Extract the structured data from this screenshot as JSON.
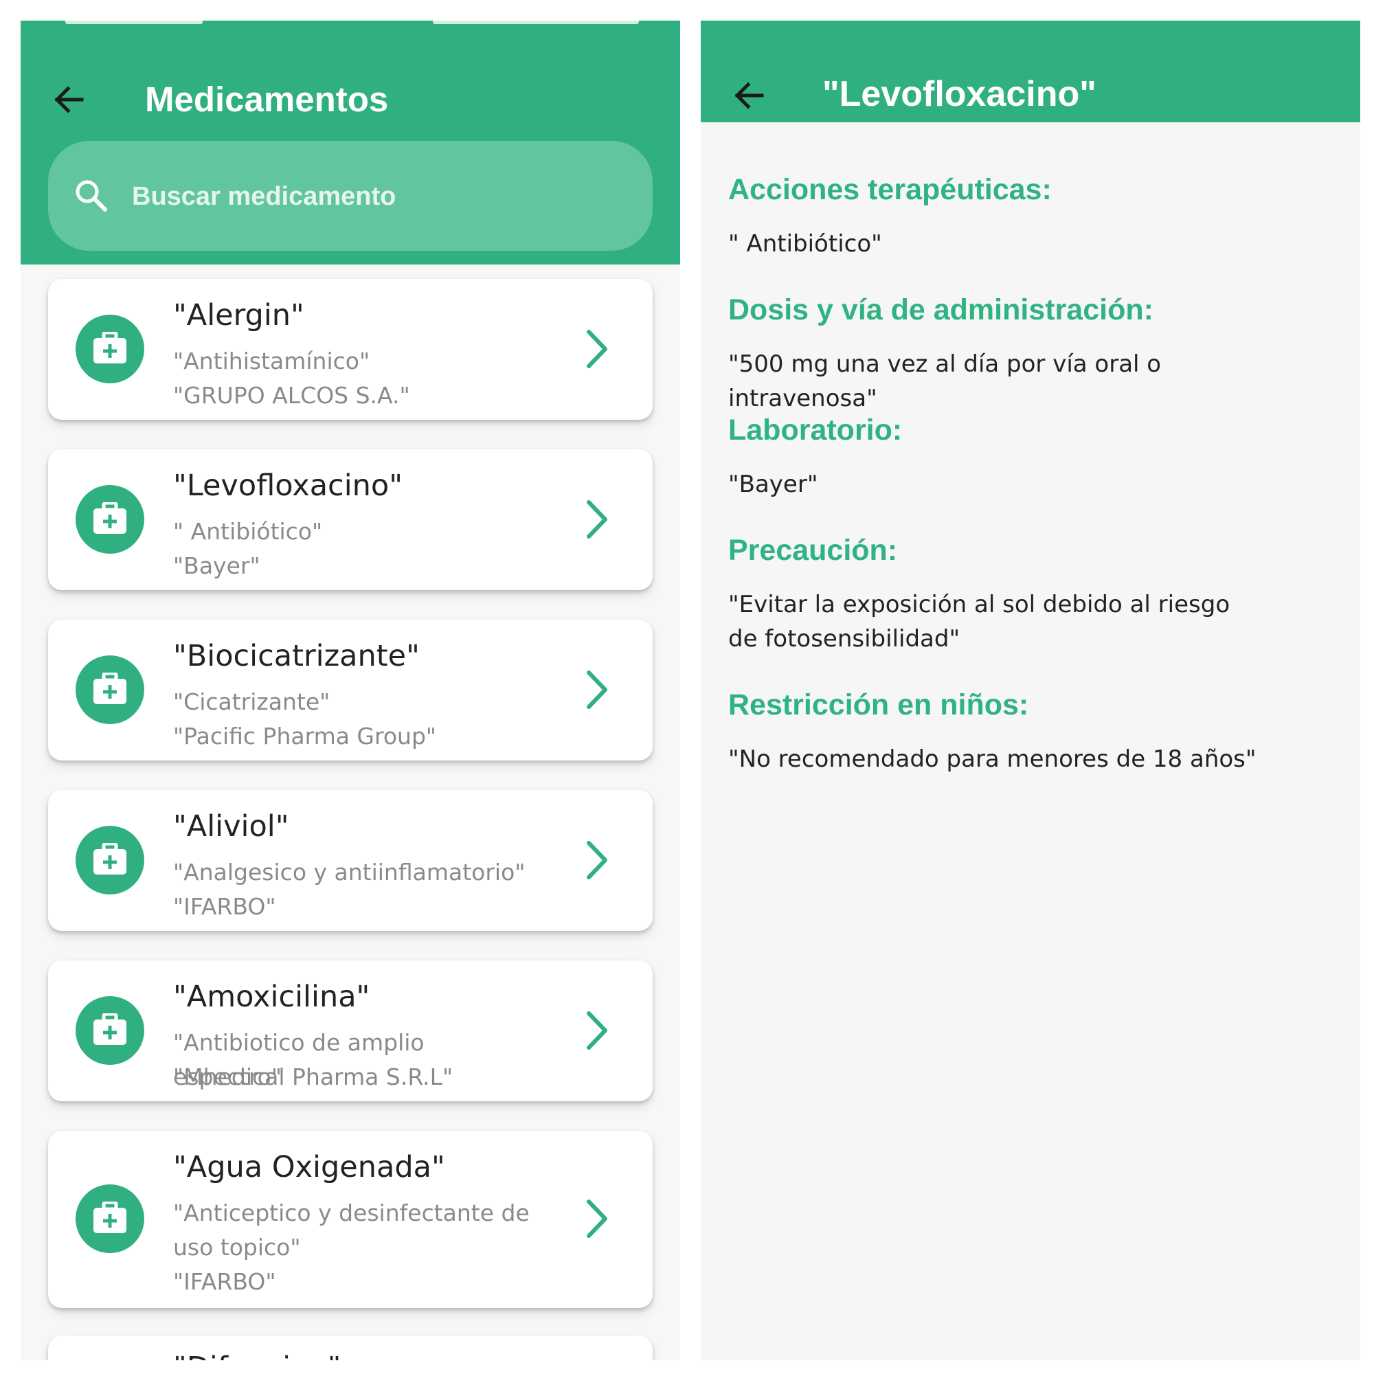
{
  "colors": {
    "primary": "#30b080",
    "search_bg": "#61c6a0",
    "section_heading": "#2fb383",
    "background": "#f7f7f7",
    "card": "#ffffff"
  },
  "list_screen": {
    "title": "Medicamentos",
    "back_icon": "arrow-left-icon",
    "search": {
      "placeholder": "Buscar medicamento",
      "icon": "search-icon"
    },
    "medicines": [
      {
        "name": "\"Alergin\"",
        "type": "\"Antihistamínico\"",
        "lab": "\"GRUPO ALCOS S.A.\"",
        "icon": "medical-kit-icon"
      },
      {
        "name": "\"Levofloxacino\"",
        "type": "\" Antibiótico\"",
        "lab": "\"Bayer\"",
        "icon": "medical-kit-icon"
      },
      {
        "name": "\"Biocicatrizante\"",
        "type": "\"Cicatrizante\"",
        "lab": "\"Pacific Pharma Group\"",
        "icon": "medical-kit-icon"
      },
      {
        "name": "\"Aliviol\"",
        "type": "\"Analgesico y antiinflamatorio\"",
        "lab": "\"IFARBO\"",
        "icon": "medical-kit-icon"
      },
      {
        "name": "\"Amoxicilina\"",
        "type": "\"Antibiotico de amplio espectro\"",
        "lab": "\"Mhedical Pharma S.R.L\"",
        "icon": "medical-kit-icon"
      },
      {
        "name": "\"Agua Oxigenada\"",
        "type": "\"Anticeptico y desinfectante de uso topico\"",
        "lab": "\"IFARBO\"",
        "icon": "medical-kit-icon"
      }
    ],
    "partial_card_name": "\"Difenvina\""
  },
  "detail_screen": {
    "title": "\"Levofloxacino\"",
    "back_icon": "arrow-left-icon",
    "sections": [
      {
        "heading": "Acciones terapéuticas:",
        "value": "\" Antibiótico\""
      },
      {
        "heading": "Dosis y vía de administración:",
        "value": "\"500 mg una vez al día por vía oral o intravenosa\""
      },
      {
        "heading": "Laboratorio:",
        "value": "\"Bayer\""
      },
      {
        "heading": "Precaución:",
        "value": "\"Evitar la exposición al sol debido al riesgo de fotosensibilidad\""
      },
      {
        "heading": "Restricción en niños:",
        "value": "\"No recomendado para menores de 18 años\""
      }
    ]
  }
}
